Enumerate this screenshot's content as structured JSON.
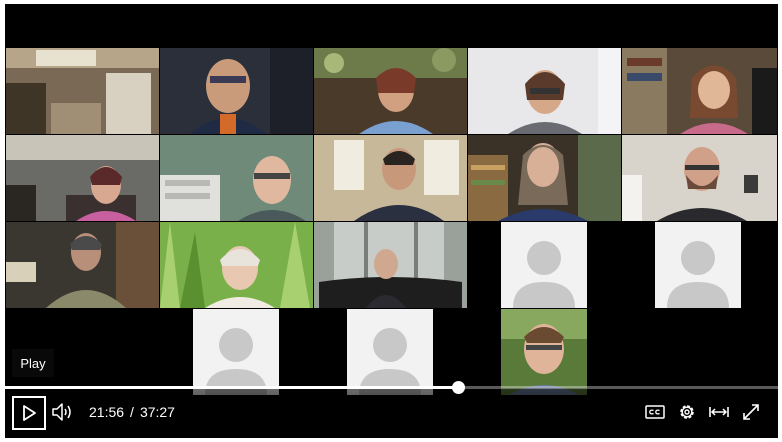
{
  "player": {
    "tooltip": "Play",
    "current_time": "21:56",
    "time_separator": "/",
    "duration": "37:27",
    "progress_fraction": 0.586
  },
  "controls": {
    "play_icon": "play-icon",
    "volume_icon": "volume-icon",
    "captions_icon": "closed-captions-icon",
    "settings_icon": "gear-icon",
    "theater_icon": "wide-mode-icon",
    "fullscreen_icon": "fullscreen-icon"
  },
  "colors": {
    "player_bg": "#000000",
    "control_fg": "#ffffff",
    "avatar_bg": "#f2f2f2",
    "avatar_silhouette": "#c8c8c8"
  },
  "grid": {
    "rows": 4,
    "columns": 5,
    "participants": [
      {
        "type": "video",
        "scene": "kitchen-empty"
      },
      {
        "type": "video",
        "scene": "man-headset-glasses"
      },
      {
        "type": "video",
        "scene": "woman-smiling-plants"
      },
      {
        "type": "video",
        "scene": "woman-glasses-white-wall"
      },
      {
        "type": "video",
        "scene": "woman-glasses-bookshelf"
      },
      {
        "type": "video",
        "scene": "woman-glasses-pink-top"
      },
      {
        "type": "video",
        "scene": "man-glasses-office"
      },
      {
        "type": "video",
        "scene": "man-window-dark"
      },
      {
        "type": "video",
        "scene": "woman-long-hair-shelves"
      },
      {
        "type": "video",
        "scene": "bald-man-beard-earbuds"
      },
      {
        "type": "video",
        "scene": "person-dim-room"
      },
      {
        "type": "video",
        "scene": "woman-grass-background"
      },
      {
        "type": "video",
        "scene": "man-leather-chair"
      },
      {
        "type": "avatar"
      },
      {
        "type": "avatar"
      },
      {
        "type": "empty"
      },
      {
        "type": "avatar"
      },
      {
        "type": "avatar"
      },
      {
        "type": "video",
        "scene": "man-glasses-smiling-outdoors"
      },
      {
        "type": "empty"
      }
    ]
  }
}
